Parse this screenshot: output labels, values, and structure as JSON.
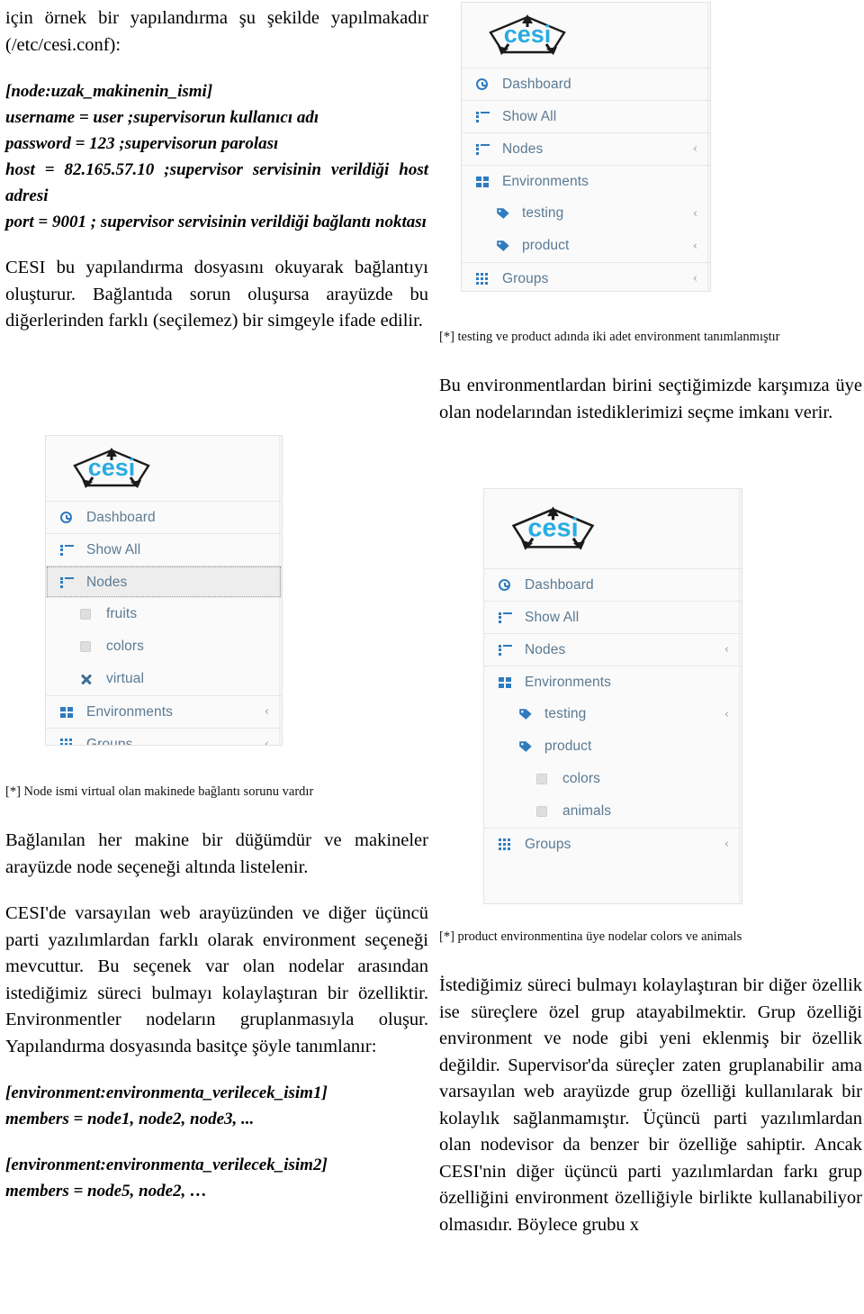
{
  "left_column": {
    "intro_paragraph": "için örnek bir yapılandırma şu şekilde yapılmakadır (/etc/cesi.conf):",
    "config_lines": [
      "[node:uzak_makinenin_ismi]",
      "username = user ;supervisorun kullanıcı adı",
      "password = 123 ;supervisorun parolası",
      "host = 82.165.57.10 ;supervisor servisinin verildiği host adresi",
      "port = 9001 ; supervisor servisinin verildiği bağlantı noktası"
    ],
    "paragraph_after_config": "CESI bu yapılandırma dosyasını okuyarak bağlantıyı oluşturur. Bağlantıda sorun oluşursa arayüzde bu diğerlerinden farklı (seçilemez) bir simgeyle ifade edilir.",
    "caption_virtual": "[*] Node ismi virtual olan makinede bağlantı sorunu vardır",
    "paragraph_nodes": "Bağlanılan her makine bir düğümdür ve makineler arayüzde node seçeneği altında listelenir.",
    "paragraph_environment": "CESI'de varsayılan web arayüzünden ve diğer üçüncü parti yazılımlardan farklı olarak environment seçeneği mevcuttur. Bu seçenek var olan nodelar arasından istediğimiz süreci bulmayı kolaylaştıran bir özelliktir. Environmentler nodeların gruplanmasıyla oluşur. Yapılandırma dosyasında basitçe şöyle tanımlanır:",
    "env_config_block_1": [
      "[environment:environmenta_verilecek_isim1]",
      "members = node1, node2, node3, ..."
    ],
    "env_config_block_2": [
      "[environment:environmenta_verilecek_isim2]",
      "members = node5, node2, …"
    ]
  },
  "right_column": {
    "caption_environments": "[*] testing ve product adında iki adet environment  tanımlanmıştır",
    "paragraph_select_env": "Bu environmentlardan birini seçtiğimizde karşımıza üye olan nodelarından istediklerimizi seçme imkanı verir.",
    "caption_product_members": "[*] product environmentina üye nodelar colors ve animals",
    "paragraph_groups": "İstediğimiz süreci bulmayı kolaylaştıran bir diğer özellik ise süreçlere özel grup atayabilmektir. Grup özelliği environment ve node gibi yeni eklenmiş bir özellik değildir. Supervisor'da süreçler zaten gruplanabilir ama varsayılan web arayüzde grup özelliği kullanılarak bir kolaylık sağlanmamıştır. Üçüncü parti yazılımlardan olan nodevisor da benzer bir özelliğe sahiptir. Ancak CESI'nin diğer üçüncü parti yazılımlardan farkı grup özelliğini environment özelliğiyle birlikte kullanabiliyor olmasıdır. Böylece grubu x"
  },
  "screenshots": {
    "brand_logo_text": "cesi",
    "brand_color": "#29ABE2",
    "link_color": "#5b7a93",
    "icon_color": "#2f7bbf",
    "panel_bg": "#fafafa",
    "panel_border": "#e3e3e3",
    "caret_collapsed": "‹",
    "caret_expanded": "ⱟ",
    "top_right_panel": {
      "items": [
        {
          "label": "Dashboard",
          "icon": "clock-icon",
          "level": 1,
          "caret": ""
        },
        {
          "label": "Show All",
          "icon": "list-icon",
          "level": 1,
          "caret": ""
        },
        {
          "label": "Nodes",
          "icon": "list-icon",
          "level": 1,
          "caret": "‹"
        },
        {
          "label": "Environments",
          "icon": "grid2-icon",
          "level": 1,
          "caret": "ⱟ"
        },
        {
          "label": "testing",
          "icon": "tag-icon",
          "level": 2,
          "caret": "‹"
        },
        {
          "label": "product",
          "icon": "tag-icon",
          "level": 2,
          "caret": "‹"
        },
        {
          "label": "Groups",
          "icon": "grid3-icon",
          "level": 1,
          "caret": "‹"
        }
      ]
    },
    "mid_left_panel": {
      "items": [
        {
          "label": "Dashboard",
          "icon": "clock-icon",
          "level": 1,
          "caret": ""
        },
        {
          "label": "Show All",
          "icon": "list-icon",
          "level": 1,
          "caret": ""
        },
        {
          "label": "Nodes",
          "icon": "list-icon",
          "level": 1,
          "caret": "ⱟ",
          "focused": true
        },
        {
          "label": "fruits",
          "icon": "checkbox-icon",
          "level": 2,
          "caret": ""
        },
        {
          "label": "colors",
          "icon": "checkbox-icon",
          "level": 2,
          "caret": ""
        },
        {
          "label": "virtual",
          "icon": "times-icon",
          "level": 2,
          "caret": ""
        },
        {
          "label": "Environments",
          "icon": "grid2-icon",
          "level": 1,
          "caret": "‹"
        },
        {
          "label": "Groups",
          "icon": "grid3-icon",
          "level": 1,
          "caret": "‹"
        }
      ]
    },
    "mid_right_panel": {
      "items": [
        {
          "label": "Dashboard",
          "icon": "clock-icon",
          "level": 1,
          "caret": ""
        },
        {
          "label": "Show All",
          "icon": "list-icon",
          "level": 1,
          "caret": ""
        },
        {
          "label": "Nodes",
          "icon": "list-icon",
          "level": 1,
          "caret": "‹"
        },
        {
          "label": "Environments",
          "icon": "grid2-icon",
          "level": 1,
          "caret": "ⱟ"
        },
        {
          "label": "testing",
          "icon": "tag-icon",
          "level": 2,
          "caret": "‹"
        },
        {
          "label": "product",
          "icon": "tag-icon",
          "level": 2,
          "caret": "ⱟ"
        },
        {
          "label": "colors",
          "icon": "checkbox-icon",
          "level": 3,
          "caret": ""
        },
        {
          "label": "animals",
          "icon": "checkbox-icon",
          "level": 3,
          "caret": ""
        },
        {
          "label": "Groups",
          "icon": "grid3-icon",
          "level": 1,
          "caret": "‹"
        }
      ]
    }
  }
}
